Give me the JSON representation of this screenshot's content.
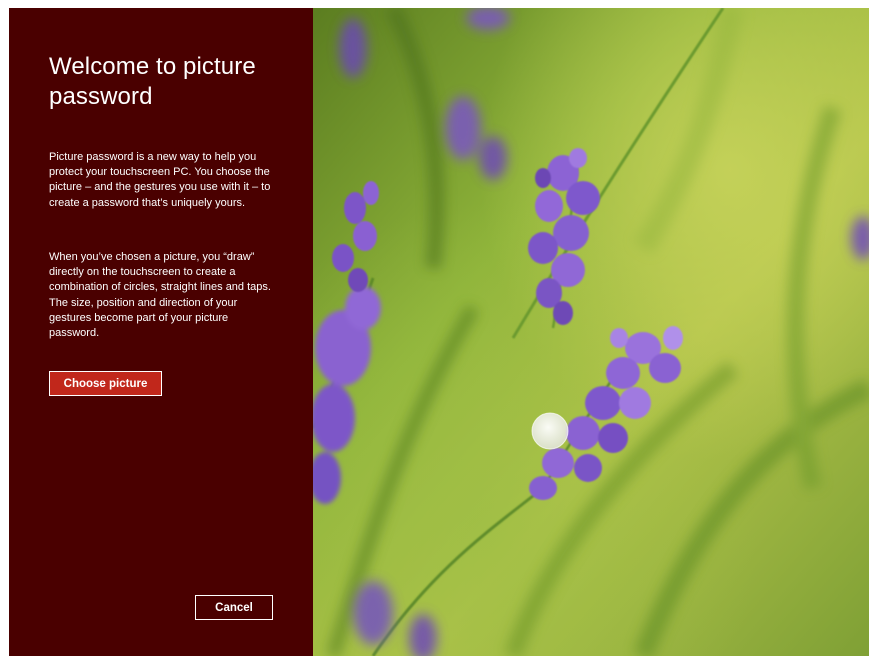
{
  "panel": {
    "title": "Welcome to picture password",
    "paragraph_1": "Picture password is a new way to help you protect your touchscreen PC. You choose the picture – and the gestures you use with it – to create a password that’s uniquely yours.",
    "paragraph_2": "When you’ve chosen a picture, you “draw” directly on the touchscreen to create a combination of circles, straight lines and taps. The size, position and direction of your gestures become part of your picture password.",
    "choose_button_label": "Choose picture",
    "cancel_button_label": "Cancel"
  },
  "colors": {
    "panel_background": "#4a0000",
    "accent_button": "#c1271b",
    "text": "#ffffff",
    "lavender": "#7a4fc2",
    "foliage": "#8cb33a"
  }
}
